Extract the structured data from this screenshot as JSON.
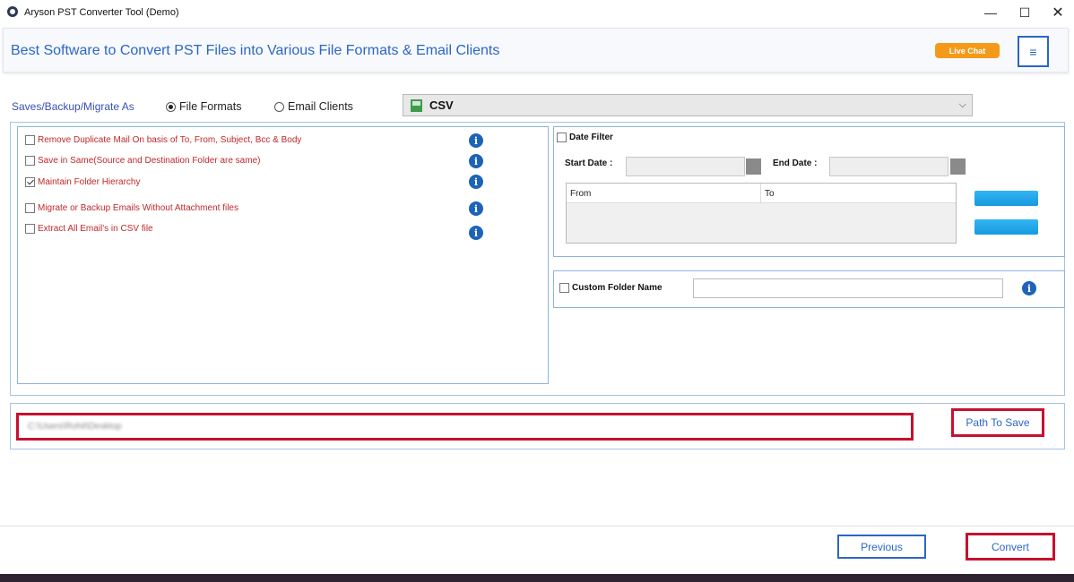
{
  "window": {
    "title": "Aryson PST Converter Tool (Demo)",
    "controls": {
      "minimize": "—",
      "maximize": "☐",
      "close": "✕"
    }
  },
  "header": {
    "title": "Best Software to Convert PST Files into Various File Formats & Email Clients",
    "live_chat": "Live Chat",
    "menu_icon": "≡"
  },
  "save_as": {
    "label": "Saves/Backup/Migrate As",
    "options": [
      {
        "label": "File Formats",
        "selected": true
      },
      {
        "label": "Email Clients",
        "selected": false
      }
    ],
    "format_select": {
      "value": "CSV",
      "icon": "csv-file-icon"
    }
  },
  "options": [
    {
      "label": "Remove Duplicate Mail On basis of To, From, Subject, Bcc & Body",
      "checked": false
    },
    {
      "label": "Save in Same(Source and Destination Folder are same)",
      "checked": false
    },
    {
      "label": "Maintain Folder Hierarchy",
      "checked": true
    },
    {
      "label": "Migrate or Backup Emails Without Attachment files",
      "checked": false
    },
    {
      "label": "Extract All Email's in CSV file",
      "checked": false
    }
  ],
  "info_glyph": "i",
  "date_filter": {
    "label": "Date Filter",
    "checked": false,
    "start_label": "Start Date :",
    "end_label": "End Date :",
    "columns": [
      "From",
      "To"
    ]
  },
  "custom_folder": {
    "label": "Custom Folder Name",
    "value": ""
  },
  "path": {
    "value": "C:\\Users\\Rohit\\Desktop",
    "button": "Path To Save"
  },
  "footer": {
    "previous": "Previous",
    "convert": "Convert"
  },
  "colors": {
    "accent": "#2a66c7",
    "highlight": "#c8102e",
    "option_text": "#c0282b",
    "live_chat": "#f49a1a"
  }
}
